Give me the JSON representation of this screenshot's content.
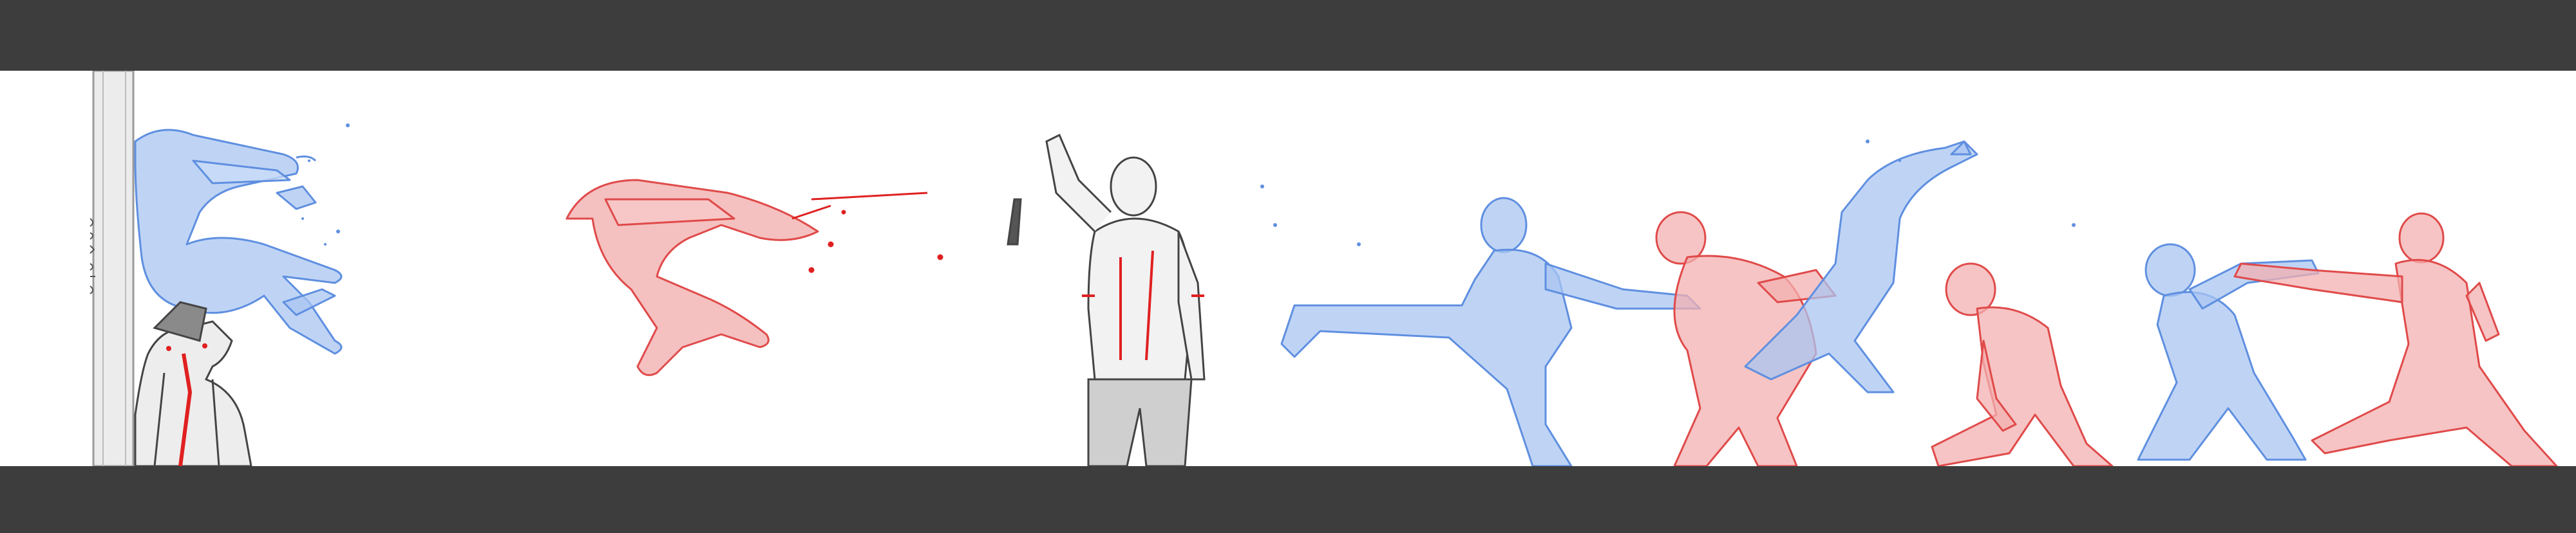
{
  "image": {
    "type": "storyboard-sketch-strip",
    "layout": "letterboxed-panel",
    "panel_background": "#ffffff",
    "letterbox_color": "#3d3d3d",
    "palette": {
      "blue_figure": "#a9c6f2",
      "blue_stroke": "#5f8fe0",
      "red_figure": "#f3b0b0",
      "red_stroke": "#e04a4a",
      "grey_figure": "#c8c8c8",
      "grey_stroke": "#555555",
      "blood_accent": "#e02020"
    },
    "figures": [
      {
        "id": "pillar",
        "color": "grey",
        "pose": "wall-column"
      },
      {
        "id": "blue-knocked-back",
        "color": "blue",
        "pose": "knocked-back-against-wall"
      },
      {
        "id": "grey-suited-man",
        "color": "grey",
        "pose": "slumped-with-red-tie"
      },
      {
        "id": "red-flying-back",
        "color": "red",
        "pose": "flying-backward-with-blood-spray"
      },
      {
        "id": "grey-shirtless-man",
        "color": "grey",
        "pose": "standing-raising-knife"
      },
      {
        "id": "blue-lunging-kick",
        "color": "blue",
        "pose": "low-lunging-kick"
      },
      {
        "id": "red-doubled-over",
        "color": "red",
        "pose": "hit-doubled-over"
      },
      {
        "id": "blue-high-kick",
        "color": "blue",
        "pose": "high-kick-leap"
      },
      {
        "id": "red-crouching",
        "color": "red",
        "pose": "crouching-guard"
      },
      {
        "id": "blue-punching",
        "color": "blue",
        "pose": "punch-extended"
      },
      {
        "id": "red-punching",
        "color": "red",
        "pose": "counter-punch"
      }
    ]
  }
}
